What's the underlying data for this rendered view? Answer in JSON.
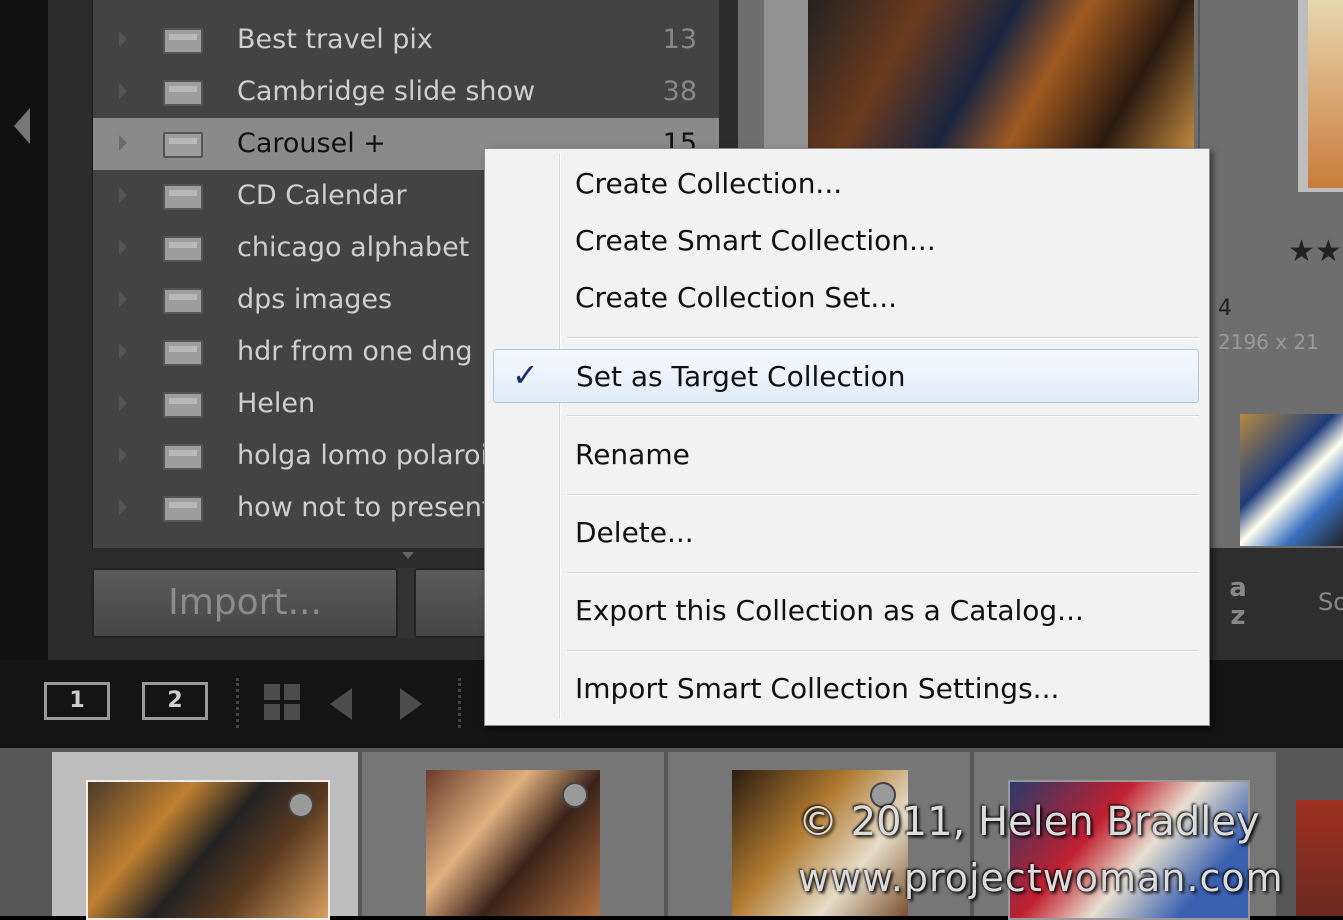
{
  "collections": [
    {
      "name": "Best travel pix",
      "count": "13",
      "selected": false
    },
    {
      "name": "Cambridge slide show",
      "count": "38",
      "selected": false
    },
    {
      "name": "Carousel  +",
      "count": "15",
      "selected": true
    },
    {
      "name": "CD Calendar",
      "count": "",
      "selected": false
    },
    {
      "name": "chicago alphabet",
      "count": "",
      "selected": false
    },
    {
      "name": "dps images",
      "count": "",
      "selected": false
    },
    {
      "name": "hdr from one dng",
      "count": "",
      "selected": false
    },
    {
      "name": "Helen",
      "count": "",
      "selected": false
    },
    {
      "name": "holga lomo polaroid",
      "count": "",
      "selected": false
    },
    {
      "name": "how not to present",
      "count": "",
      "selected": false
    }
  ],
  "buttons": {
    "import": "Import...",
    "export": ""
  },
  "context_menu": {
    "items": [
      {
        "label": "Create Collection...",
        "checked": false
      },
      {
        "label": "Create Smart Collection...",
        "checked": false
      },
      {
        "label": "Create Collection Set...",
        "checked": false
      },
      {
        "label": "Set as Target Collection",
        "checked": true
      },
      {
        "label": "Rename",
        "checked": false
      },
      {
        "label": "Delete...",
        "checked": false
      },
      {
        "label": "Export this Collection as a Catalog...",
        "checked": false
      },
      {
        "label": "Import Smart Collection Settings...",
        "checked": false
      }
    ],
    "check_glyph": "✓"
  },
  "grid": {
    "rating": "★★",
    "photo_number": "4",
    "dimensions": "2196 x 21",
    "sort_icon": "a z",
    "sort_label": "So"
  },
  "filmstrip": {
    "screen1": "1",
    "screen2": "2"
  },
  "watermark": {
    "line1": "© 2011, Helen Bradley",
    "line2": "www.projectwoman.com"
  },
  "colors": {
    "panel_bg": "#434343",
    "selected_row": "#8a8a8a",
    "menu_bg": "#f2f2f2",
    "menu_highlight": "#e1ecf8",
    "check": "#1a2c6e"
  }
}
